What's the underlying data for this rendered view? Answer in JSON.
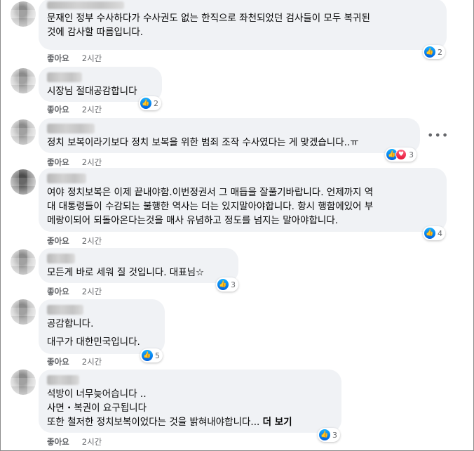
{
  "comments": [
    {
      "author": "",
      "lines": [
        "문재인 정부 수사하다가 수사권도 없는 한직으로 좌천되었던 검사들이 모두 복귀된",
        "것에 감사할 따름입니다."
      ],
      "like_label": "좋아요",
      "time": "2시간",
      "reaction_count": "2"
    },
    {
      "author": "",
      "lines": [
        "시장님 절대공감합니다"
      ],
      "like_label": "좋아요",
      "time": "2시간",
      "reaction_count": "2"
    },
    {
      "author": "",
      "lines": [
        "정치 보복이라기보다 정치 보복을 위한 범죄 조작 수사였다는 게 맞겠습니다..ㅠ"
      ],
      "like_label": "좋아요",
      "time": "2시간",
      "reaction_count": "3",
      "more_icon": "•••"
    },
    {
      "author": "",
      "lines": [
        "여야 정치보복은 이제 끝내야함.이번정권서 그 매듭을 잘풀기바랍니다. 언제까지 역",
        "대 대통령들이 수감되는 불행한 역사는 더는 있지말아야합니다. 항시 행함에있어 부",
        "메랑이되어 되돌아온다는것을 매사 유념하고 정도를 넘지는 말아야합니다."
      ],
      "like_label": "좋아요",
      "time": "2시간",
      "reaction_count": "4"
    },
    {
      "author": "",
      "lines": [
        "모든게 바로 세워 질 것입니다. 대표님☆"
      ],
      "like_label": "좋아요",
      "time": "2시간",
      "reaction_count": "3"
    },
    {
      "author": "",
      "lines": [
        "공감합니다.",
        "대구가 대한민국입니다."
      ],
      "like_label": "좋아요",
      "time": "2시간",
      "reaction_count": "5"
    },
    {
      "author": "",
      "lines": [
        "석방이 너무늦어습니다 ‥",
        "사면・복권이 요구됩니다",
        "또한 철저한 정치보복이었다는 것을 밝혀내야합니다..."
      ],
      "see_more": "더 보기",
      "like_label": "좋아요",
      "time": "2시간",
      "reaction_count": "3"
    }
  ],
  "icons": {
    "like": "thumbs-up-icon",
    "love": "heart-icon",
    "more": "more-options-icon"
  },
  "colors": {
    "bubble": "#f0f2f5",
    "like_blue": "#1877f2",
    "love_red": "#f33e58",
    "meta_gray": "#65676b"
  }
}
